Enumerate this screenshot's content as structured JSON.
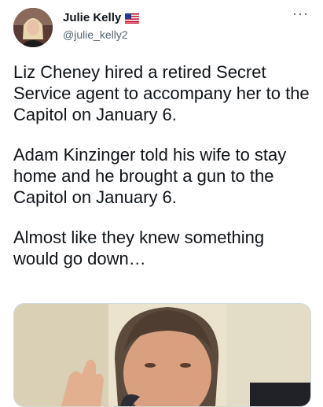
{
  "tweet": {
    "author_name": "Julie Kelly",
    "author_handle": "@julie_kelly2",
    "more_label": "···",
    "paragraphs": [
      "Liz Cheney hired a retired Secret Service agent to accompany her to the Capitol on January 6.",
      "Adam Kinzinger told his wife to stay home and he brought a gun to the Capitol on January 6.",
      "Almost like they knew something would go down…"
    ]
  },
  "icons": {
    "avatar": "profile-photo",
    "flag": "us-flag-icon",
    "more": "more-options-icon"
  }
}
